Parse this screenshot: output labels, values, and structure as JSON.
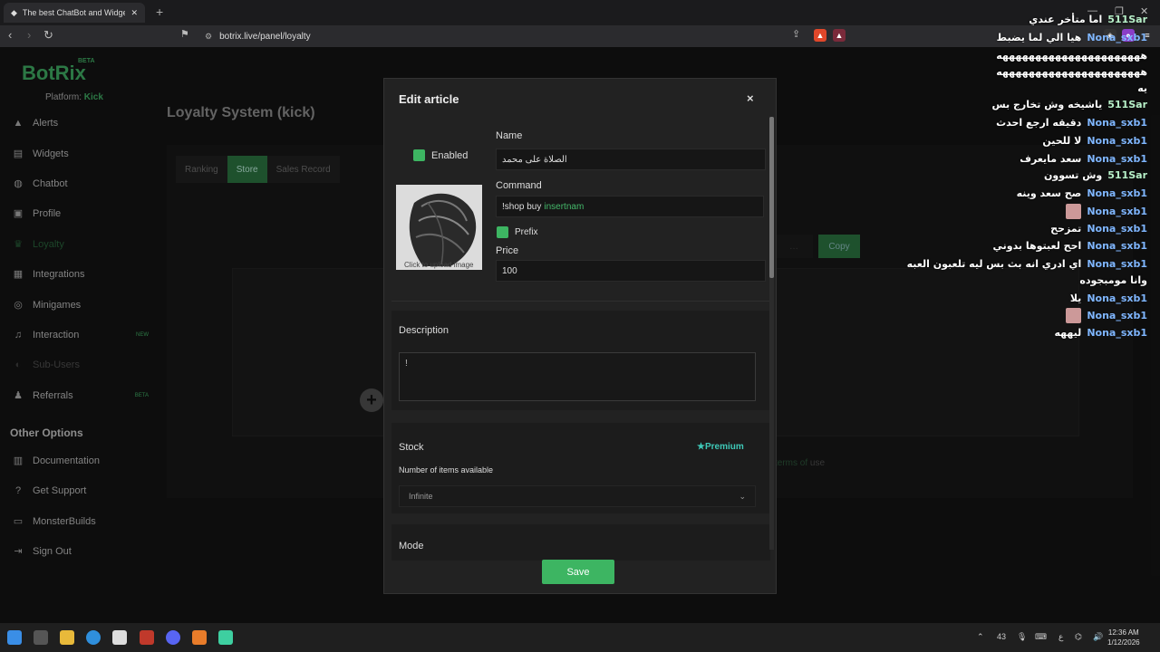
{
  "browser": {
    "tab_title": "The best ChatBot and Widgets f",
    "url": "botrix.live/panel/loyalty"
  },
  "sidebar": {
    "logo": "BotRix",
    "beta": "BETA",
    "platform_label": "Platform:",
    "platform_value": "Kick",
    "items": [
      {
        "label": "Alerts",
        "icon": "alert-icon"
      },
      {
        "label": "Widgets",
        "icon": "widgets-icon"
      },
      {
        "label": "Chatbot",
        "icon": "robot-icon"
      },
      {
        "label": "Profile",
        "icon": "profile-icon"
      },
      {
        "label": "Loyalty",
        "icon": "trophy-icon"
      },
      {
        "label": "Integrations",
        "icon": "integrations-icon"
      },
      {
        "label": "Minigames",
        "icon": "gamepad-icon"
      },
      {
        "label": "Interaction",
        "icon": "music-icon",
        "badge": "NEW"
      },
      {
        "label": "Sub-Users",
        "icon": "users-icon"
      },
      {
        "label": "Referrals",
        "icon": "referrals-icon",
        "badge": "BETA"
      }
    ],
    "other_options_title": "Other Options",
    "other_items": [
      {
        "label": "Documentation",
        "icon": "document-icon"
      },
      {
        "label": "Get Support",
        "icon": "support-icon"
      },
      {
        "label": "MonsterBuilds",
        "icon": "monitor-icon"
      },
      {
        "label": "Sign Out",
        "icon": "signout-icon"
      }
    ]
  },
  "main": {
    "title": "Loyalty System (kick)",
    "tabs": [
      "Ranking",
      "Store",
      "Sales Record"
    ],
    "copy_label": "Copy",
    "terms_prefix": "terms of",
    "terms_suffix": "use"
  },
  "modal": {
    "title": "Edit article",
    "close": "×",
    "enabled_label": "Enabled",
    "name_label": "Name",
    "name_value": "الصلاة على محمد",
    "command_label": "Command",
    "command_value": "!shop buy",
    "command_highlight": "insertnam",
    "prefix_label": "Prefix",
    "price_label": "Price",
    "price_value": "100",
    "upload_caption": "Click to upload image",
    "description_label": "Description",
    "description_value": "!",
    "stock_label": "Stock",
    "premium_label": "Premium",
    "stock_sub": "Number of items available",
    "stock_value": "Infinite",
    "mode_label": "Mode",
    "save_label": "Save"
  },
  "chat": [
    {
      "user": "511Sar",
      "msg": "اما متأخر عندي"
    },
    {
      "user": "Nona_sxb1",
      "msg": "هيا الي لما يضبط"
    },
    {
      "user": "",
      "msg": "ههههههههههههههههههههههه"
    },
    {
      "user": "",
      "msg": "ههههههههههههههههههههههه"
    },
    {
      "user": "",
      "msg": "يه"
    },
    {
      "user": "511Sar",
      "msg": "ياشيخه وش تخارج بس"
    },
    {
      "user": "Nona_sxb1",
      "msg": "دقيقه ارجع احدث"
    },
    {
      "user": "Nona_sxb1",
      "msg": "لا للحين"
    },
    {
      "user": "Nona_sxb1",
      "msg": "سعد مايعرف"
    },
    {
      "user": "511Sar",
      "msg": "وش تسوون"
    },
    {
      "user": "Nona_sxb1",
      "msg": "صح سعد وينه"
    },
    {
      "user": "Nona_sxb1",
      "msg": ""
    },
    {
      "user": "Nona_sxb1",
      "msg": "تمزحح"
    },
    {
      "user": "Nona_sxb1",
      "msg": "احح لعبتوها بدوني"
    },
    {
      "user": "Nona_sxb1",
      "msg": "اي ادري انه بث بس ليه تلعبون العبه"
    },
    {
      "user": "",
      "msg": "وانا مومبجوده"
    },
    {
      "user": "Nona_sxb1",
      "msg": "يلا"
    },
    {
      "user": "Nona_sxb1",
      "msg": ""
    },
    {
      "user": "Nona_sxb1",
      "msg": "ليههه"
    }
  ],
  "taskbar": {
    "tray_count": "43",
    "time": "12:36 AM",
    "date": "1/12/2026"
  },
  "colors": {
    "accent": "#3db562",
    "premium": "#3fc9b8",
    "chat_user": "#7fb6ff"
  }
}
